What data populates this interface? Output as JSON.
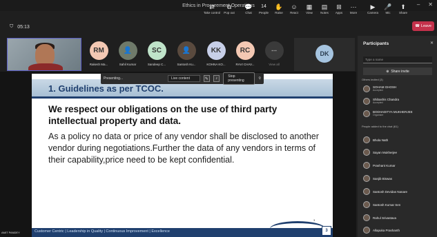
{
  "window": {
    "title": "Ethics in Procurement Operations",
    "minimize": "–",
    "close": "✕"
  },
  "toolbar": {
    "timer": "05:13",
    "buttons": [
      {
        "label": "Take control",
        "icon": "⇄"
      },
      {
        "label": "Pop out",
        "icon": "⧉"
      },
      {
        "label": "Chat",
        "icon": "💬"
      },
      {
        "label": "People",
        "icon": "14",
        "icon_name": "people-icon"
      },
      {
        "label": "Raise",
        "icon": "✋"
      },
      {
        "label": "React",
        "icon": "☺"
      },
      {
        "label": "View",
        "icon": "▦"
      },
      {
        "label": "Notes",
        "icon": "▤"
      },
      {
        "label": "Apps",
        "icon": "⊞"
      },
      {
        "label": "More",
        "icon": "⋯"
      },
      {
        "label": "Camera",
        "icon": "▶"
      },
      {
        "label": "Mic",
        "icon": "🎤"
      },
      {
        "label": "Share",
        "icon": "⬆"
      }
    ],
    "leave_label": "Leave"
  },
  "participants_strip": [
    {
      "initials": "RM",
      "name": "Rakesh Ma...",
      "color": "#f3c8b3"
    },
    {
      "initials": "",
      "name": "Sahil Kumar",
      "color": "#6f7a6a"
    },
    {
      "initials": "SC",
      "name": "Sandeep C...",
      "color": "#bfe3c9"
    },
    {
      "initials": "",
      "name": "Santosh Ku...",
      "color": "#5a4a3e"
    },
    {
      "initials": "KK",
      "name": "KOHNA KO...",
      "color": "#c7cfe8"
    },
    {
      "initials": "RC",
      "name": "RAVI CHAV...",
      "color": "#f3c8b3"
    },
    {
      "initials": "",
      "name": "View all",
      "color": "#3a3a3a"
    }
  ],
  "dk_tile": {
    "initials": "DK"
  },
  "share_bar": {
    "status": "Presenting...",
    "mode": "Live content",
    "stop_label": "Stop presenting"
  },
  "slide": {
    "heading": "1. Guidelines as per TCOC.",
    "bold_text": "We respect our obligations on the use of third party intellectual property and data.",
    "body_text": "As a policy no data or price of any vendor shall be disclosed to another vendor during negotiations.Further the data of any vendors in terms of their capability,price need to be kept confidential.",
    "footer": "Customer Centric | Leadership in Quality | Continuous Improvement | Excellence",
    "page_number": "3",
    "small_number": "3"
  },
  "self_name": "AMIT PANDEY",
  "panel": {
    "title": "Participants",
    "search_placeholder": "Type a name",
    "share_invite": "Share invite",
    "section_invited": "Others invited (3)",
    "invited": [
      {
        "name": "SOHAM GHOSH",
        "status": "Accepted"
      },
      {
        "name": "Shibashis Chandra",
        "status": "Accepted"
      },
      {
        "name": "BODHADITYA MUKHERJEE",
        "status": "Organiser"
      }
    ],
    "section_added": "People added to the chat (61)",
    "people": [
      {
        "name": "Bhola Nath"
      },
      {
        "name": "Sayan Mukherjee"
      },
      {
        "name": "Prashant Kumar"
      },
      {
        "name": "Sanjib Biswas"
      },
      {
        "name": "Santosh Devidas Nanare"
      },
      {
        "name": "Santosh Kumar Sen"
      },
      {
        "name": "Rahul Srivastava"
      },
      {
        "name": "Allapuka Prashanth"
      }
    ]
  }
}
